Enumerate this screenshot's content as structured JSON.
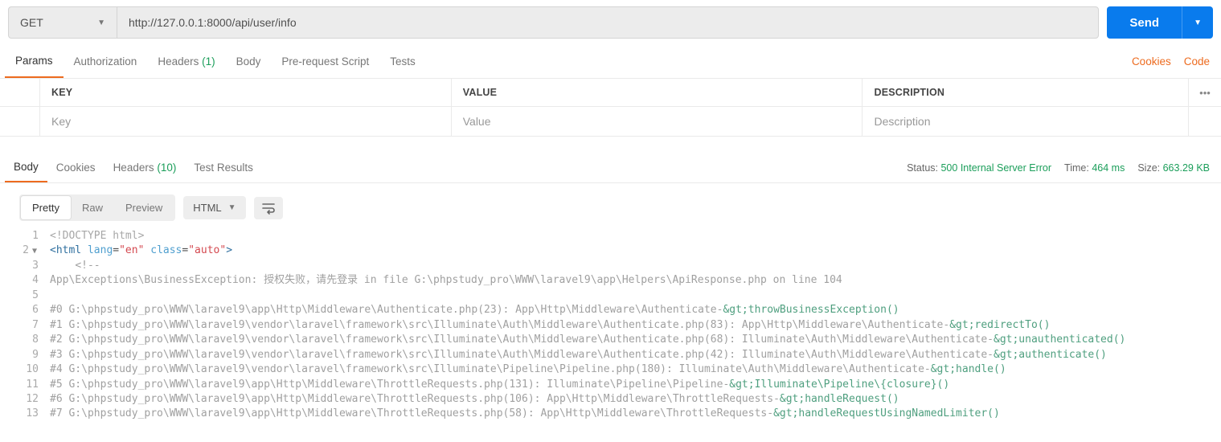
{
  "request": {
    "method": "GET",
    "url": "http://127.0.0.1:8000/api/user/info",
    "send_label": "Send"
  },
  "request_tabs": {
    "params": "Params",
    "authorization": "Authorization",
    "headers_label": "Headers",
    "headers_count": "(1)",
    "body": "Body",
    "prerequest": "Pre-request Script",
    "tests": "Tests",
    "cookies_link": "Cookies",
    "code_link": "Code"
  },
  "params_table": {
    "key_header": "KEY",
    "value_header": "VALUE",
    "desc_header": "DESCRIPTION",
    "key_placeholder": "Key",
    "value_placeholder": "Value",
    "desc_placeholder": "Description"
  },
  "response_tabs": {
    "body": "Body",
    "cookies": "Cookies",
    "headers_label": "Headers",
    "headers_count": "(10)",
    "test_results": "Test Results"
  },
  "response_meta": {
    "status_label": "Status:",
    "status_value": "500 Internal Server Error",
    "time_label": "Time:",
    "time_value": "464 ms",
    "size_label": "Size:",
    "size_value": "663.29 KB"
  },
  "format_bar": {
    "pretty": "Pretty",
    "raw": "Raw",
    "preview": "Preview",
    "lang": "HTML"
  },
  "code_lines": [
    {
      "n": 1,
      "html": "<span class=\"c-doctype\">&lt;!DOCTYPE html&gt;</span>"
    },
    {
      "n": 2,
      "fold": true,
      "html": "<span class=\"c-angle\">&lt;</span><span class=\"c-tag\">html</span> <span class=\"c-attr\">lang</span>=<span class=\"c-str\">\"en\"</span> <span class=\"c-attr\">class</span>=<span class=\"c-str\">\"auto\"</span><span class=\"c-angle\">&gt;</span>"
    },
    {
      "n": 3,
      "html": "    <span class=\"c-comment\">&lt;!--</span>"
    },
    {
      "n": 4,
      "html": "<span class=\"c-comment\">App\\Exceptions\\BusinessException: 授权失败，请先登录 in file G:\\phpstudy_pro\\WWW\\laravel9\\app\\Helpers\\ApiResponse.php on line 104</span>"
    },
    {
      "n": 5,
      "html": ""
    },
    {
      "n": 6,
      "html": "<span class=\"c-comment\">#0 G:\\phpstudy_pro\\WWW\\laravel9\\app\\Http\\Middleware\\Authenticate.php(23): App\\Http\\Middleware\\Authenticate-</span><span class=\"c-text\">&amp;gt;throwBusinessException()</span>"
    },
    {
      "n": 7,
      "html": "<span class=\"c-comment\">#1 G:\\phpstudy_pro\\WWW\\laravel9\\vendor\\laravel\\framework\\src\\Illuminate\\Auth\\Middleware\\Authenticate.php(83): App\\Http\\Middleware\\Authenticate-</span><span class=\"c-text\">&amp;gt;redirectTo()</span>"
    },
    {
      "n": 8,
      "html": "<span class=\"c-comment\">#2 G:\\phpstudy_pro\\WWW\\laravel9\\vendor\\laravel\\framework\\src\\Illuminate\\Auth\\Middleware\\Authenticate.php(68): Illuminate\\Auth\\Middleware\\Authenticate-</span><span class=\"c-text\">&amp;gt;unauthenticated()</span>"
    },
    {
      "n": 9,
      "html": "<span class=\"c-comment\">#3 G:\\phpstudy_pro\\WWW\\laravel9\\vendor\\laravel\\framework\\src\\Illuminate\\Auth\\Middleware\\Authenticate.php(42): Illuminate\\Auth\\Middleware\\Authenticate-</span><span class=\"c-text\">&amp;gt;authenticate()</span>"
    },
    {
      "n": 10,
      "html": "<span class=\"c-comment\">#4 G:\\phpstudy_pro\\WWW\\laravel9\\vendor\\laravel\\framework\\src\\Illuminate\\Pipeline\\Pipeline.php(180): Illuminate\\Auth\\Middleware\\Authenticate-</span><span class=\"c-text\">&amp;gt;handle()</span>"
    },
    {
      "n": 11,
      "html": "<span class=\"c-comment\">#5 G:\\phpstudy_pro\\WWW\\laravel9\\app\\Http\\Middleware\\ThrottleRequests.php(131): Illuminate\\Pipeline\\Pipeline-</span><span class=\"c-text\">&amp;gt;Illuminate\\Pipeline\\{closure}()</span>"
    },
    {
      "n": 12,
      "html": "<span class=\"c-comment\">#6 G:\\phpstudy_pro\\WWW\\laravel9\\app\\Http\\Middleware\\ThrottleRequests.php(106): App\\Http\\Middleware\\ThrottleRequests-</span><span class=\"c-text\">&amp;gt;handleRequest()</span>"
    },
    {
      "n": 13,
      "html": "<span class=\"c-comment\">#7 G:\\phpstudy_pro\\WWW\\laravel9\\app\\Http\\Middleware\\ThrottleRequests.php(58): App\\Http\\Middleware\\ThrottleRequests-</span><span class=\"c-text\">&amp;gt;handleRequestUsingNamedLimiter()</span>"
    }
  ]
}
